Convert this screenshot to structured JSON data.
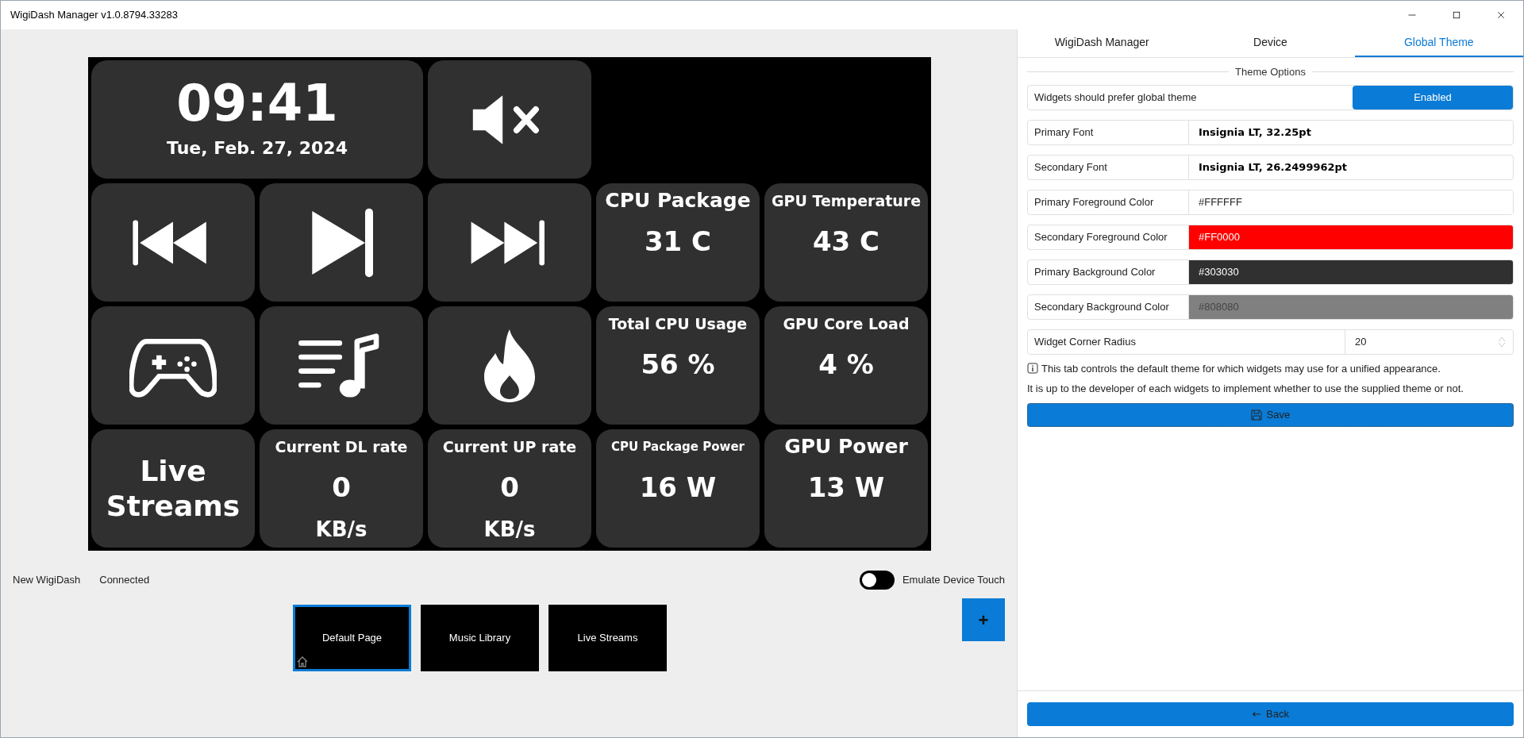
{
  "window": {
    "title": "WigiDash Manager v1.0.8794.33283"
  },
  "dashboard": {
    "widgets": [
      {
        "kind": "clock",
        "time": "09:41",
        "date": "Tue, Feb. 27, 2024"
      },
      {
        "kind": "icon"
      },
      {
        "kind": "blank"
      },
      {
        "kind": "icon"
      },
      {
        "kind": "icon"
      },
      {
        "kind": "icon"
      },
      {
        "kind": "sensor",
        "title": "CPU Package",
        "value": "31 C"
      },
      {
        "kind": "sensor",
        "title": "GPU Temperature",
        "value": "43 C"
      },
      {
        "kind": "icon"
      },
      {
        "kind": "icon"
      },
      {
        "kind": "icon"
      },
      {
        "kind": "sensor",
        "title": "Total CPU Usage",
        "value": "56 %"
      },
      {
        "kind": "sensor",
        "title": "GPU Core Load",
        "value": "4 %"
      },
      {
        "kind": "text",
        "text": "Live Streams"
      },
      {
        "kind": "sensor",
        "title": "Current DL rate",
        "value": "0",
        "unit": "KB/s"
      },
      {
        "kind": "sensor",
        "title": "Current UP rate",
        "value": "0",
        "unit": "KB/s"
      },
      {
        "kind": "sensor",
        "title": "CPU Package Power",
        "value": "16 W"
      },
      {
        "kind": "sensor",
        "title": "GPU Power",
        "value": "13 W"
      }
    ]
  },
  "device": {
    "name": "New WigiDash",
    "status": "Connected",
    "emulate_touch": {
      "label": "Emulate Device Touch",
      "on": false
    }
  },
  "pages": [
    {
      "label": "Default Page",
      "selected": true,
      "home": true
    },
    {
      "label": "Music Library",
      "selected": false,
      "home": false
    },
    {
      "label": "Live Streams",
      "selected": false,
      "home": false
    }
  ],
  "add_page_button": "+",
  "tabs": [
    {
      "label": "WigiDash Manager",
      "selected": false
    },
    {
      "label": "Device",
      "selected": false
    },
    {
      "label": "Global Theme",
      "selected": true
    }
  ],
  "theme_options": {
    "heading": "Theme Options",
    "prefer_global": {
      "label": "Widgets should prefer global theme",
      "button": "Enabled"
    },
    "rows": [
      {
        "kind": "font",
        "label": "Primary Font",
        "value": "Insignia LT, 32.25pt"
      },
      {
        "kind": "font",
        "label": "Secondary Font",
        "value": "Insignia LT, 26.2499962pt"
      },
      {
        "kind": "color",
        "label": "Primary Foreground Color",
        "value": "#FFFFFF",
        "color": "#ffffff"
      },
      {
        "kind": "color",
        "label": "Secondary Foreground Color",
        "value": "#FF0000",
        "color": "#ff0000"
      },
      {
        "kind": "color",
        "label": "Primary Background Color",
        "value": "#303030",
        "color": "#303030"
      },
      {
        "kind": "color",
        "label": "Secondary Background Color",
        "value": "#808080",
        "color": "#808080"
      },
      {
        "kind": "number",
        "label": "Widget Corner Radius",
        "value": "20"
      }
    ],
    "info": "This tab controls the default theme for which widgets may use for a unified appearance.",
    "note": "It is up to the developer of each widgets to implement whether to use the supplied theme or not.",
    "save_button": "Save"
  },
  "back_button": "Back"
}
